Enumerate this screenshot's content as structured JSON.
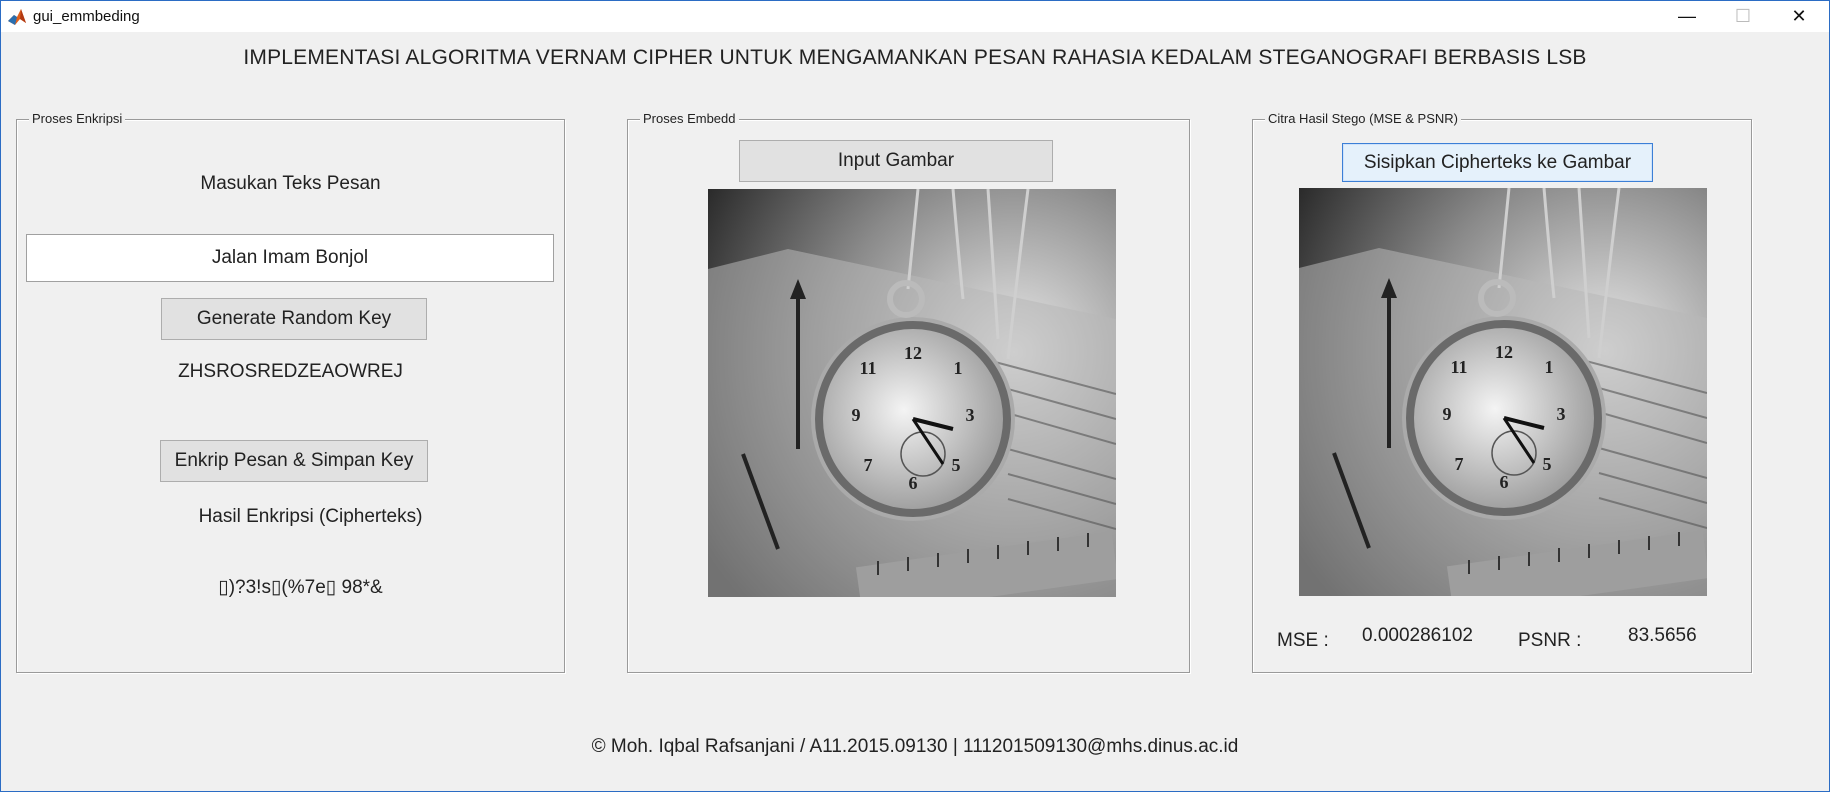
{
  "window": {
    "title": "gui_emmbeding",
    "minimize_glyph": "—",
    "maximize_glyph": "☐",
    "close_glyph": "✕"
  },
  "main_title": "IMPLEMENTASI ALGORITMA VERNAM CIPHER UNTUK MENGAMANKAN PESAN RAHASIA KEDALAM STEGANOGRAFI BERBASIS LSB",
  "panel_enkripsi": {
    "title": "Proses Enkripsi",
    "message_label": "Masukan Teks Pesan",
    "message_value": "Jalan Imam Bonjol",
    "generate_key_button": "Generate Random Key",
    "random_key": "ZHSROSREDZEAOWREJ",
    "encrypt_button": "Enkrip Pesan & Simpan Key",
    "result_label": "Hasil Enkripsi (Cipherteks)",
    "ciphertext": "▯)?3!s▯(%7e▯ 98*&"
  },
  "panel_embedd": {
    "title": "Proses Embedd",
    "input_button": "Input Gambar",
    "image_desc": "pocket-watch-image"
  },
  "panel_stego": {
    "title": "Citra Hasil Stego (MSE & PSNR)",
    "embed_button": "Sisipkan Cipherteks ke Gambar",
    "mse_label": "MSE :",
    "mse_value": "0.000286102",
    "psnr_label": "PSNR :",
    "psnr_value": "83.5656"
  },
  "footer": "© Moh. Iqbal Rafsanjani / A11.2015.09130  | 111201509130@mhs.dinus.ac.id"
}
